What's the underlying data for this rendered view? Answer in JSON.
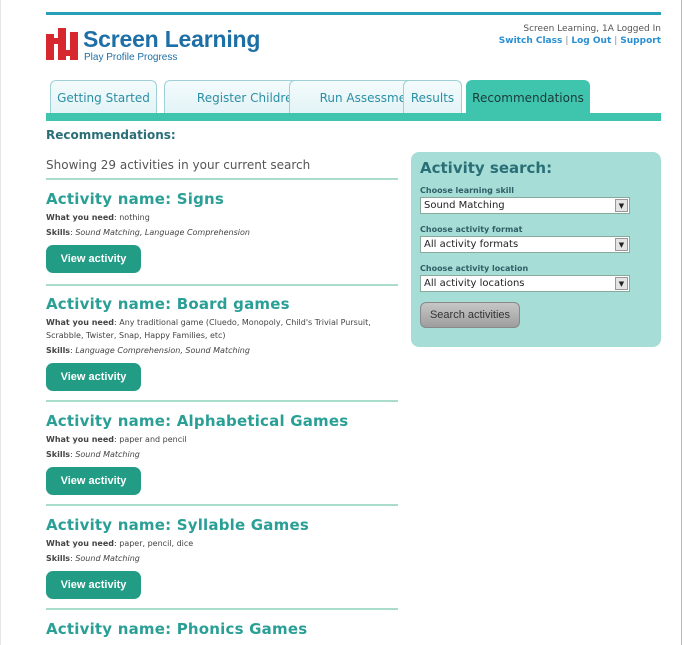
{
  "brand": {
    "title": "Screen Learning",
    "subtitle": "Play Profile Progress",
    "colors": {
      "primary": "#1d6fa5",
      "accent": "#3fc5ad",
      "button": "#229c85",
      "logo_red": "#d8282f"
    }
  },
  "user": {
    "status": "Screen Learning, 1A Logged In",
    "links": [
      "Switch Class",
      "Log Out",
      "Support"
    ]
  },
  "tabs": [
    {
      "label": "Getting Started"
    },
    {
      "label": "Register Children"
    },
    {
      "label": "Run Assessment"
    },
    {
      "label": "Results"
    },
    {
      "label": "Recommendations"
    }
  ],
  "page_title": "Recommendations:",
  "summary": "Showing 29 activities in your current search",
  "labels": {
    "need": "What you need",
    "skills": "Skills",
    "view": "View activity"
  },
  "activities": [
    {
      "name": "Activity name: Signs",
      "need": ": nothing",
      "skills": "Sound Matching, Language Comprehension"
    },
    {
      "name": "Activity name: Board games",
      "need": ": Any traditional game (Cluedo, Monopoly, Child's Trivial Pursuit, Scrabble, Twister, Snap, Happy Families, etc)",
      "skills": "Language Comprehension, Sound Matching"
    },
    {
      "name": "Activity name: Alphabetical Games",
      "need": ": paper and pencil",
      "skills": "Sound Matching"
    },
    {
      "name": "Activity name: Syllable Games",
      "need": ": paper, pencil, dice",
      "skills": "Sound Matching"
    },
    {
      "name": "Activity name: Phonics Games"
    }
  ],
  "search": {
    "title": "Activity search:",
    "skill_label": "Choose learning skill",
    "skill_value": "Sound Matching",
    "format_label": "Choose activity format",
    "format_value": "All activity formats",
    "location_label": "Choose activity location",
    "location_value": "All activity locations",
    "button": "Search activities"
  }
}
